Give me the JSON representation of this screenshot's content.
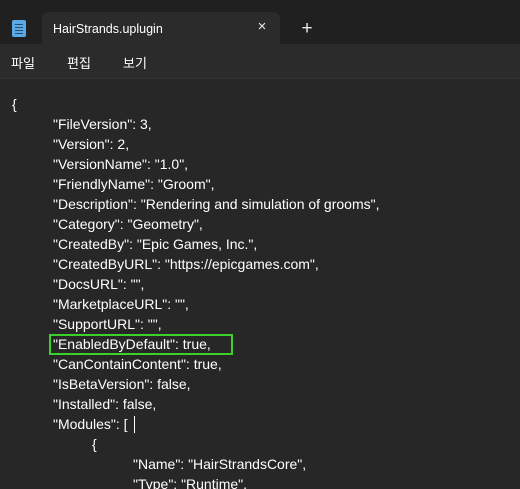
{
  "tab": {
    "title": "HairStrands.uplugin",
    "close_icon": "×",
    "new_tab_icon": "+"
  },
  "menu": {
    "file": "파일",
    "edit": "편집",
    "view": "보기"
  },
  "editor": {
    "highlight_color": "#39d12a",
    "lines": [
      "{",
      "\"FileVersion\": 3,",
      "\"Version\": 2,",
      "\"VersionName\": \"1.0\",",
      "\"FriendlyName\": \"Groom\",",
      "\"Description\": \"Rendering and simulation of grooms\",",
      "\"Category\": \"Geometry\",",
      "\"CreatedBy\": \"Epic Games, Inc.\",",
      "\"CreatedByURL\": \"https://epicgames.com\",",
      "\"DocsURL\": \"\",",
      "\"MarketplaceURL\": \"\",",
      "\"SupportURL\": \"\",",
      "\"EnabledByDefault\": true,",
      "\"CanContainContent\": true,",
      "\"IsBetaVersion\": false,",
      "\"Installed\": false,",
      "\"Modules\": [",
      "{",
      "\"Name\": \"HairStrandsCore\",",
      "\"Type\": \"Runtime\","
    ]
  }
}
